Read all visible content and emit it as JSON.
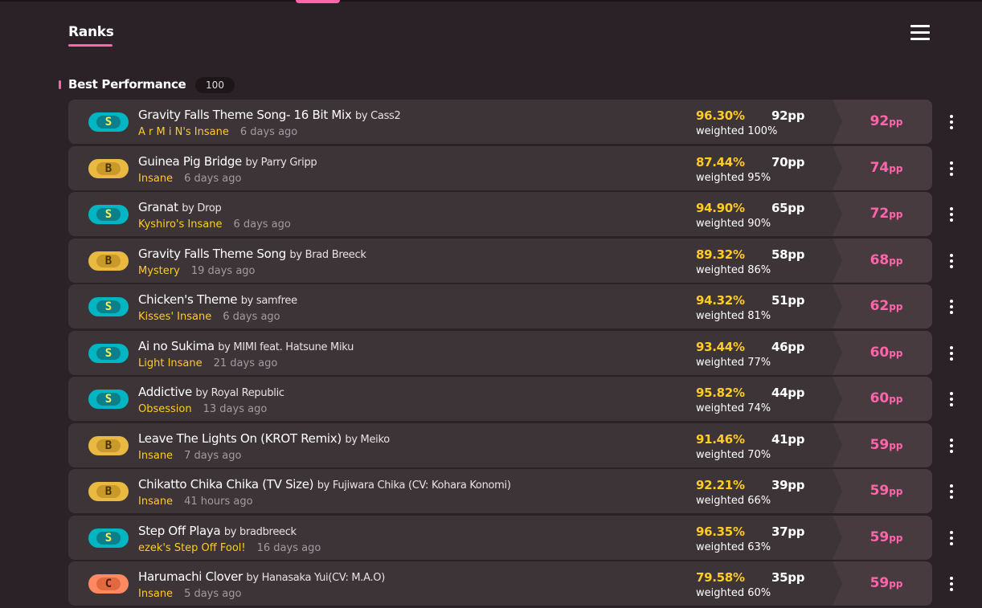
{
  "nav": {
    "tab_label": "Ranks",
    "menu_icon": "hamburger-menu-icon"
  },
  "section": {
    "title": "Best Performance",
    "count": "100"
  },
  "colors": {
    "accent": "#ff66aa",
    "accuracy": "#ffcc22",
    "rank_s": "#02b5c3",
    "rank_b": "#e9b941",
    "rank_c": "#ff8a62"
  },
  "scores": [
    {
      "grade": "S",
      "title": "Gravity Falls Theme Song- 16 Bit Mix",
      "by": "by Cass2",
      "difficulty": "A r M i N's Insane",
      "ago": "6 days ago",
      "accuracy": "96.30%",
      "pp": "92pp",
      "weighted": "weighted 100%",
      "total_value": "92",
      "total_unit": "pp"
    },
    {
      "grade": "B",
      "title": "Guinea Pig Bridge",
      "by": "by Parry Gripp",
      "difficulty": "Insane",
      "ago": "6 days ago",
      "accuracy": "87.44%",
      "pp": "70pp",
      "weighted": "weighted 95%",
      "total_value": "74",
      "total_unit": "pp"
    },
    {
      "grade": "S",
      "title": "Granat",
      "by": "by Drop",
      "difficulty": "Kyshiro's Insane",
      "ago": "6 days ago",
      "accuracy": "94.90%",
      "pp": "65pp",
      "weighted": "weighted 90%",
      "total_value": "72",
      "total_unit": "pp"
    },
    {
      "grade": "B",
      "title": "Gravity Falls Theme Song",
      "by": "by Brad Breeck",
      "difficulty": "Mystery",
      "ago": "19 days ago",
      "accuracy": "89.32%",
      "pp": "58pp",
      "weighted": "weighted 86%",
      "total_value": "68",
      "total_unit": "pp"
    },
    {
      "grade": "S",
      "title": "Chicken's Theme",
      "by": "by samfree",
      "difficulty": "Kisses' Insane",
      "ago": "6 days ago",
      "accuracy": "94.32%",
      "pp": "51pp",
      "weighted": "weighted 81%",
      "total_value": "62",
      "total_unit": "pp"
    },
    {
      "grade": "S",
      "title": "Ai no Sukima",
      "by": "by MIMI feat. Hatsune Miku",
      "difficulty": "Light Insane",
      "ago": "21 days ago",
      "accuracy": "93.44%",
      "pp": "46pp",
      "weighted": "weighted 77%",
      "total_value": "60",
      "total_unit": "pp"
    },
    {
      "grade": "S",
      "title": "Addictive",
      "by": "by Royal Republic",
      "difficulty": "Obsession",
      "ago": "13 days ago",
      "accuracy": "95.82%",
      "pp": "44pp",
      "weighted": "weighted 74%",
      "total_value": "60",
      "total_unit": "pp"
    },
    {
      "grade": "B",
      "title": "Leave The Lights On (KROT Remix)",
      "by": "by Meiko",
      "difficulty": "Insane",
      "ago": "7 days ago",
      "accuracy": "91.46%",
      "pp": "41pp",
      "weighted": "weighted 70%",
      "total_value": "59",
      "total_unit": "pp"
    },
    {
      "grade": "B",
      "title": "Chikatto Chika Chika (TV Size)",
      "by": "by Fujiwara Chika (CV: Kohara Konomi)",
      "difficulty": "Insane",
      "ago": "41 hours ago",
      "accuracy": "92.21%",
      "pp": "39pp",
      "weighted": "weighted 66%",
      "total_value": "59",
      "total_unit": "pp"
    },
    {
      "grade": "S",
      "title": "Step Off Playa",
      "by": "by bradbreeck",
      "difficulty": "ezek's Step Off Fool!",
      "ago": "16 days ago",
      "accuracy": "96.35%",
      "pp": "37pp",
      "weighted": "weighted 63%",
      "total_value": "59",
      "total_unit": "pp"
    },
    {
      "grade": "C",
      "title": "Harumachi Clover",
      "by": "by Hanasaka Yui(CV: M.A.O)",
      "difficulty": "Insane",
      "ago": "5 days ago",
      "accuracy": "79.58%",
      "pp": "35pp",
      "weighted": "weighted 60%",
      "total_value": "59",
      "total_unit": "pp"
    }
  ]
}
